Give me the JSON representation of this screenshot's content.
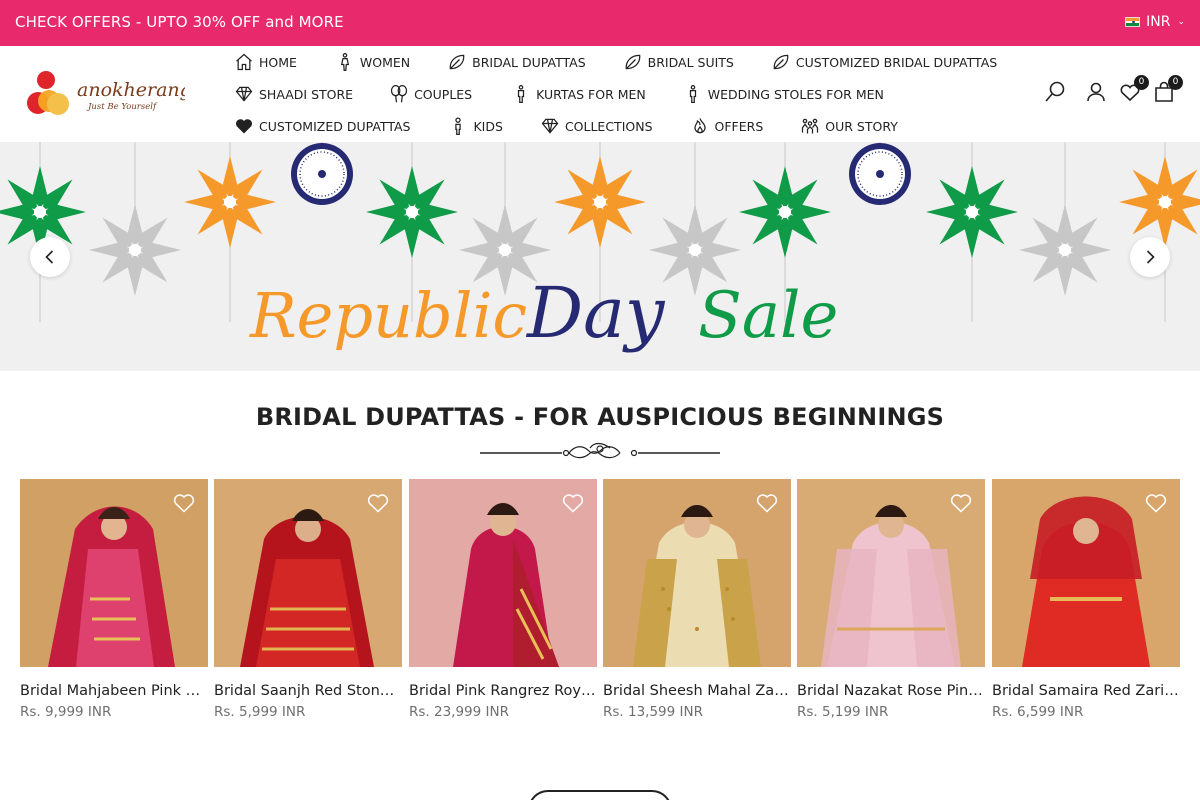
{
  "announcement": {
    "text": "CHECK OFFERS - UPTO 30% OFF and MORE"
  },
  "currency": {
    "code": "INR",
    "flag_icon": "india-flag-icon"
  },
  "brand": {
    "name": "anokherang",
    "tagline": "Just Be Yourself",
    "colors": {
      "red": "#e0242c",
      "orange": "#f6a623",
      "text": "#7a3c1b"
    }
  },
  "nav": {
    "row1": [
      {
        "label": "HOME",
        "icon": "home-icon"
      },
      {
        "label": "WOMEN",
        "icon": "woman-icon"
      },
      {
        "label": "BRIDAL DUPATTAS",
        "icon": "leaf-icon"
      },
      {
        "label": "BRIDAL SUITS",
        "icon": "leaf-icon"
      },
      {
        "label": "CUSTOMIZED BRIDAL DUPATTAS",
        "icon": "leaf-icon"
      }
    ],
    "row2": [
      {
        "label": "SHAADI STORE",
        "icon": "diamond-icon"
      },
      {
        "label": "COUPLES",
        "icon": "balloons-icon"
      },
      {
        "label": "KURTAS FOR MEN",
        "icon": "man-icon"
      },
      {
        "label": "WEDDING STOLES FOR MEN",
        "icon": "man-icon"
      }
    ],
    "row3": [
      {
        "label": "CUSTOMIZED DUPATTAS",
        "icon": "heart-filled-icon"
      },
      {
        "label": "KIDS",
        "icon": "kid-icon"
      },
      {
        "label": "COLLECTIONS",
        "icon": "diamond-icon"
      },
      {
        "label": "OFFERS",
        "icon": "flame-icon"
      },
      {
        "label": "OUR STORY",
        "icon": "team-icon"
      }
    ]
  },
  "header_tools": {
    "wishlist_count": "0",
    "cart_count": "0"
  },
  "hero": {
    "words": [
      "Republic",
      "Day",
      "Sale"
    ],
    "colors": {
      "saffron": "#f6992b",
      "navy": "#262a72",
      "green": "#0f9b47",
      "grey": "#c4c4c4",
      "background": "#f0f0f0"
    }
  },
  "section": {
    "title": "BRIDAL DUPATTAS - FOR AUSPICIOUS BEGINNINGS"
  },
  "products": [
    {
      "name": "Bridal Mahjabeen Pink and Gold Banarasi Dupatta",
      "price": "Rs. 9,999 INR"
    },
    {
      "name": "Bridal Saanjh Red Stone Work Dupatta",
      "price": "Rs. 5,999 INR"
    },
    {
      "name": "Bridal Pink Rangrez Royal Dupatta",
      "price": "Rs. 23,999 INR"
    },
    {
      "name": "Bridal Sheesh Mahal Zari Dupatta",
      "price": "Rs. 13,599 INR"
    },
    {
      "name": "Bridal Nazakat Rose Pink Tissue Dupatta",
      "price": "Rs. 5,199 INR"
    },
    {
      "name": "Bridal Samaira Red Zari Dupatta",
      "price": "Rs. 6,599 INR"
    }
  ]
}
